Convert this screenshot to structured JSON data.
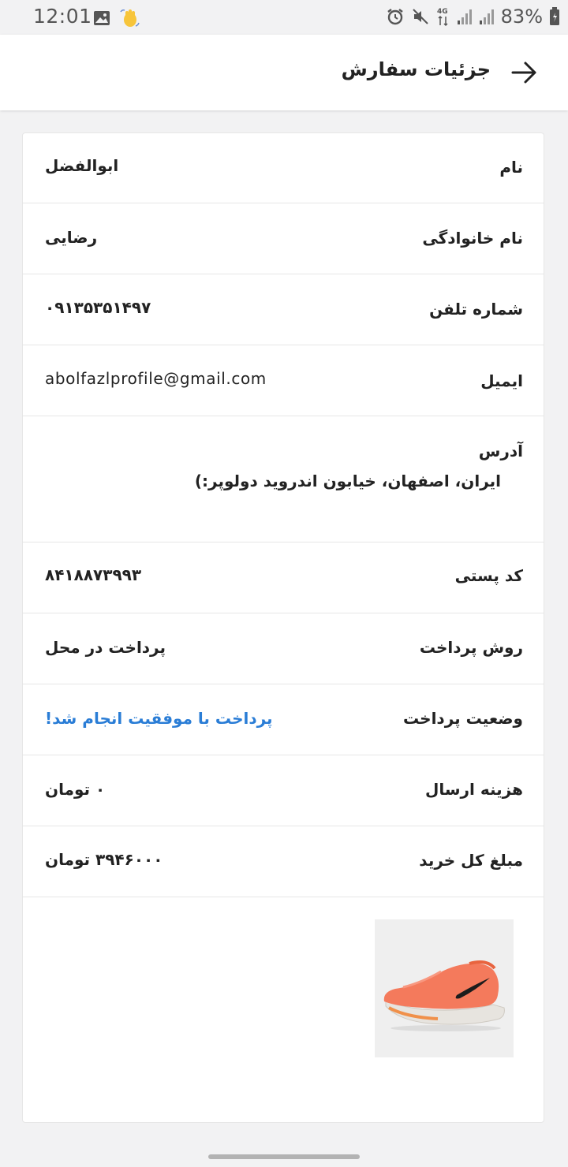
{
  "status_bar": {
    "time": "12:01",
    "battery": "83%",
    "network": "4G"
  },
  "header": {
    "title": "جزئیات سفارش"
  },
  "order": {
    "first_name": {
      "label": "نام",
      "value": "ابوالفضل"
    },
    "last_name": {
      "label": "نام خانوادگی",
      "value": "رضایی"
    },
    "phone": {
      "label": "شماره تلفن",
      "value": "۰۹۱۳۵۳۵۱۴۹۷"
    },
    "email": {
      "label": "ایمیل",
      "value": "abolfazlprofile@gmail.com"
    },
    "address": {
      "label": "آدرس",
      "value": "ایران، اصفهان، خیابون اندروید دولوپر:)"
    },
    "postal_code": {
      "label": "کد پستی",
      "value": "۸۴۱۸۸۷۳۹۹۳"
    },
    "payment_method": {
      "label": "روش پرداخت",
      "value": "پرداخت در محل"
    },
    "payment_status": {
      "label": "وضعیت پرداخت",
      "value": "پرداخت با موفقیت انجام شد!"
    },
    "shipping_cost": {
      "label": "هزینه ارسال",
      "value": "۰ تومان"
    },
    "total": {
      "label": "مبلغ کل خرید",
      "value": "۳۹۴۶۰۰۰ تومان"
    }
  },
  "colors": {
    "accent_link": "#2a7dd6",
    "background": "#f2f2f3",
    "card": "#ffffff",
    "shoe": "#f47a5c"
  },
  "icons": {
    "back": "arrow-right-icon",
    "gallery": "image-icon",
    "wave": "waving-hand-icon",
    "alarm": "alarm-icon",
    "mute": "mute-icon"
  }
}
